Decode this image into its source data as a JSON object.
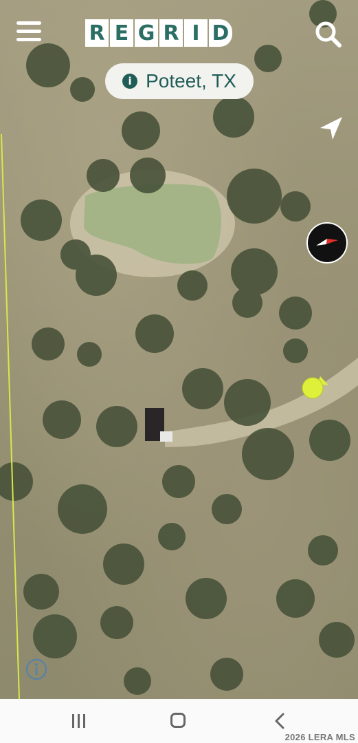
{
  "app": {
    "logo_letters": [
      "R",
      "E",
      "G",
      "R",
      "I",
      "D"
    ],
    "location_label": "Poteet, TX"
  },
  "icons": {
    "menu": "hamburger-menu-icon",
    "search": "search-icon",
    "info": "info-icon",
    "navigate": "navigation-arrow-icon",
    "compass": "compass-icon",
    "user_location": "user-location-dot",
    "map_info": "map-info-icon"
  },
  "colors": {
    "brand": "#2b6e64",
    "parcel_line": "#d8e84a",
    "location_dot": "#dff03a"
  },
  "system_nav": {
    "recent": "recent-apps-icon",
    "home": "home-icon",
    "back": "back-icon"
  },
  "watermark": "2026 LERA MLS"
}
